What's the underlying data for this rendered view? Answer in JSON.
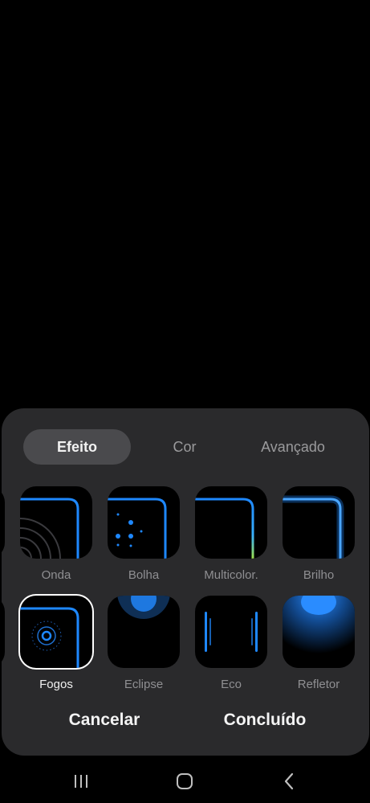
{
  "tabs": [
    {
      "label": "Efeito",
      "active": true
    },
    {
      "label": "Cor",
      "active": false
    },
    {
      "label": "Avançado",
      "active": false
    }
  ],
  "effects_row1": [
    {
      "label": "Onda",
      "icon": "wave-preview-icon"
    },
    {
      "label": "Bolha",
      "icon": "bubble-preview-icon"
    },
    {
      "label": "Multicolor.",
      "icon": "multicolor-preview-icon"
    },
    {
      "label": "Brilho",
      "icon": "glow-preview-icon"
    }
  ],
  "effects_row2": [
    {
      "label": "Fogos",
      "icon": "fireworks-preview-icon",
      "selected": true
    },
    {
      "label": "Eclipse",
      "icon": "eclipse-preview-icon"
    },
    {
      "label": "Eco",
      "icon": "echo-preview-icon"
    },
    {
      "label": "Refletor",
      "icon": "spotlight-preview-icon"
    }
  ],
  "actions": {
    "cancel_label": "Cancelar",
    "done_label": "Concluído"
  },
  "colors": {
    "accent_blue": "#1e88ff",
    "panel_bg": "#2a2a2c",
    "tab_active_bg": "#4a4a4d"
  }
}
